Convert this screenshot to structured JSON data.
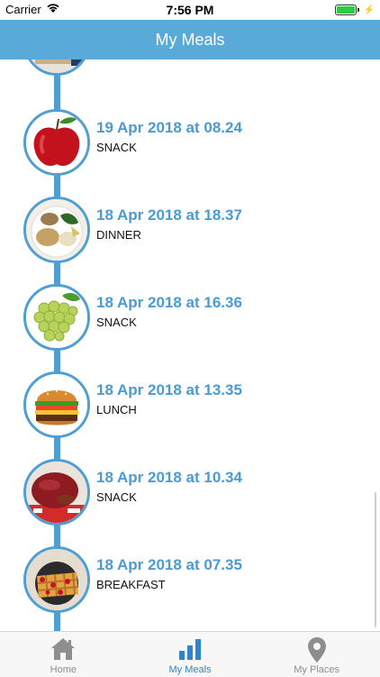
{
  "status_bar": {
    "carrier": "Carrier",
    "time": "7:56 PM",
    "battery_level": 1.0
  },
  "nav": {
    "title": "My Meals"
  },
  "meals": [
    {
      "date": "19 Apr 2018 at 08.24",
      "type": "SNACK",
      "image": "apple"
    },
    {
      "date": "18 Apr 2018 at 18.37",
      "type": "DINNER",
      "image": "dinner-plate"
    },
    {
      "date": "18 Apr 2018 at 16.36",
      "type": "SNACK",
      "image": "grapes"
    },
    {
      "date": "18 Apr 2018 at 13.35",
      "type": "LUNCH",
      "image": "burger"
    },
    {
      "date": "18 Apr 2018 at 10.34",
      "type": "SNACK",
      "image": "mango"
    },
    {
      "date": "18 Apr 2018 at 07.35",
      "type": "BREAKFAST",
      "image": "waffle"
    }
  ],
  "tabs": [
    {
      "label": "Home",
      "icon": "home-icon",
      "active": false
    },
    {
      "label": "My Meals",
      "icon": "bar-chart-icon",
      "active": true
    },
    {
      "label": "My Places",
      "icon": "location-pin-icon",
      "active": false
    }
  ],
  "colors": {
    "nav_bg": "#5aaad9",
    "accent": "#4f9fd3",
    "date_text": "#4a9bd2",
    "tab_active": "#2f84cf"
  }
}
